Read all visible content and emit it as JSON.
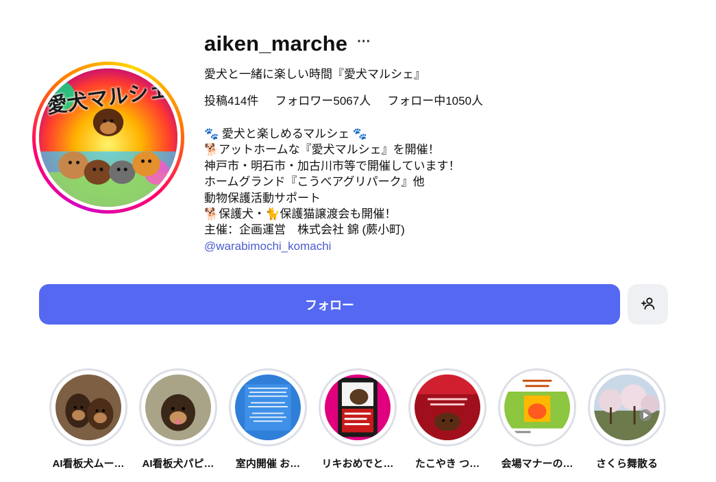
{
  "profile": {
    "username": "aiken_marche",
    "more_label": "···",
    "full_name": "愛犬と一緒に楽しい時間『愛犬マルシェ』",
    "stats": {
      "posts": "投稿414件",
      "followers": "フォロワー5067人",
      "following": "フォロー中1050人"
    },
    "bio_lines": [
      "🐾 愛犬と楽しめるマルシェ 🐾",
      "🐕アットホームな『愛犬マルシェ』を開催！",
      "神戸市・明石市・加古川市等で開催しています！",
      "ホームグランド『こうべアグリパーク』他",
      "動物保護活動サポート",
      "🐕保護犬・🐈保護猫譲渡会も開催！",
      "主催：企画運営　株式会社 錦 (蕨小町)"
    ],
    "bio_link": "@warabimochi_komachi",
    "avatar_title": "愛犬マルシェ"
  },
  "actions": {
    "follow_label": "フォロー",
    "add_user_icon": "add-user-icon"
  },
  "highlights": [
    {
      "label": "AI看板犬ムー…"
    },
    {
      "label": "AI看板犬パピ…"
    },
    {
      "label": "室内開催 お…"
    },
    {
      "label": "リキおめでと…"
    },
    {
      "label": "たこやき つ…"
    },
    {
      "label": "会場マナーの…"
    },
    {
      "label": "さくら舞散る"
    }
  ],
  "colors": {
    "follow_button": "#5468f2",
    "link": "#4a5bd0",
    "ring_gradient": [
      "#d300c5",
      "#ff0169",
      "#ff7a00",
      "#ffd600"
    ]
  }
}
